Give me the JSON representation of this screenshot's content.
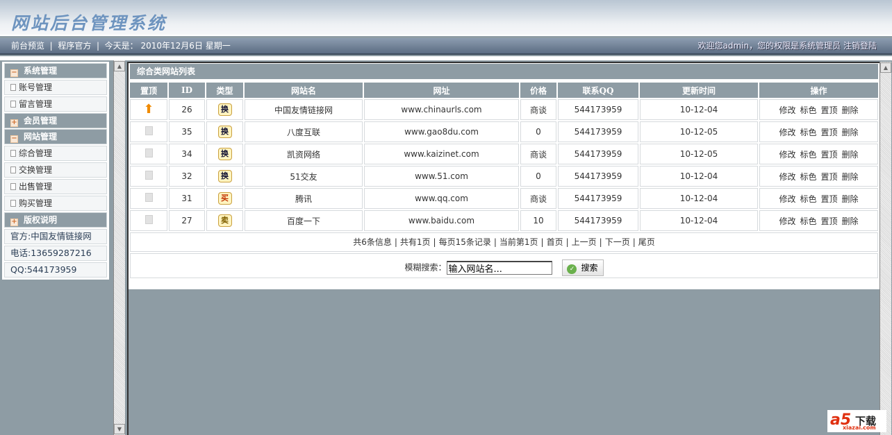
{
  "header": {
    "logo": "网站后台管理系统"
  },
  "nav": {
    "links": [
      "前台预览",
      "程序官方"
    ],
    "today_label": "今天是：",
    "date": "2010年12月6日",
    "weekday": "星期一",
    "welcome": "欢迎您admin，您的权限是系统管理员",
    "logout": "注销登陆"
  },
  "sidebar": {
    "groups": [
      {
        "title": "系统管理",
        "icon": "minus",
        "items": [
          "账号管理",
          "留言管理"
        ]
      },
      {
        "title": "会员管理",
        "icon": "plus",
        "items": []
      },
      {
        "title": "网站管理",
        "icon": "minus",
        "items": [
          "综合管理",
          "交换管理",
          "出售管理",
          "购买管理"
        ]
      },
      {
        "title": "版权说明",
        "icon": "plus",
        "items": []
      }
    ],
    "copyright": [
      "官方:中国友情链接网",
      "电话:13659287216",
      "QQ:544173959"
    ]
  },
  "main": {
    "title": "综合类网站列表",
    "columns": [
      "置顶",
      "ID",
      "类型",
      "网站名",
      "网址",
      "价格",
      "联系QQ",
      "更新时间",
      "操作"
    ],
    "rows": [
      {
        "top": true,
        "id": "26",
        "type": "换",
        "name": "中国友情链接网",
        "url": "www.chinaurls.com",
        "price": "商谈",
        "qq": "544173959",
        "updated": "10-12-04"
      },
      {
        "top": false,
        "id": "35",
        "type": "换",
        "name": "八度互联",
        "url": "www.gao8du.com",
        "price": "0",
        "qq": "544173959",
        "updated": "10-12-05"
      },
      {
        "top": false,
        "id": "34",
        "type": "换",
        "name": "凯资网络",
        "url": "www.kaizinet.com",
        "price": "商谈",
        "qq": "544173959",
        "updated": "10-12-05"
      },
      {
        "top": false,
        "id": "32",
        "type": "换",
        "name": "51交友",
        "url": "www.51.com",
        "price": "0",
        "qq": "544173959",
        "updated": "10-12-04"
      },
      {
        "top": false,
        "id": "31",
        "type": "买",
        "name": "腾讯",
        "url": "www.qq.com",
        "price": "商谈",
        "qq": "544173959",
        "updated": "10-12-04"
      },
      {
        "top": false,
        "id": "27",
        "type": "卖",
        "name": "百度一下",
        "url": "www.baidu.com",
        "price": "10",
        "qq": "544173959",
        "updated": "10-12-04"
      }
    ],
    "actions": [
      "修改",
      "标色",
      "置顶",
      "删除"
    ],
    "pager": [
      "共6条信息",
      "共有1页",
      "每页15条记录",
      "当前第1页",
      "首页",
      "上一页",
      "下一页",
      "尾页"
    ],
    "search": {
      "label": "模糊搜索：",
      "value": "输入网站名...",
      "button": "搜索"
    }
  },
  "watermark": {
    "brand": "a5",
    "text": "下载",
    "url": "xiazai.com"
  }
}
